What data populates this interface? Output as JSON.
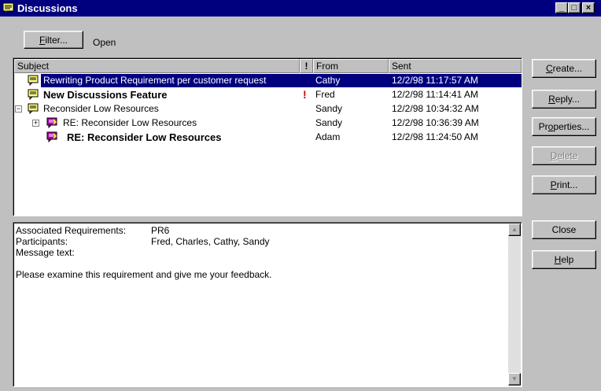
{
  "window": {
    "title": "Discussions",
    "minimize": "_",
    "maximize": "□",
    "close": "×"
  },
  "toolbar": {
    "filter_label": "Filter...",
    "filter_mnemonic": "F",
    "filter_rest": "ilter...",
    "status": "Open"
  },
  "list": {
    "columns": {
      "subject": "Subject",
      "priority": "!",
      "from": "From",
      "sent": "Sent"
    },
    "rows": [
      {
        "subject": "Rewriting Product Requirement per customer request",
        "priority": "",
        "from": "Cathy",
        "sent": "12/2/98 11:17:57 AM"
      },
      {
        "subject": "New Discussions Feature",
        "priority": "!",
        "from": "Fred",
        "sent": "12/2/98 11:14:41 AM"
      },
      {
        "subject": "Reconsider Low Resources",
        "priority": "",
        "from": "Sandy",
        "sent": "12/2/98 10:34:32 AM"
      },
      {
        "subject": "RE: Reconsider Low Resources",
        "priority": "",
        "from": "Sandy",
        "sent": "12/2/98 10:36:39 AM"
      },
      {
        "subject": "RE: Reconsider Low Resources",
        "priority": "",
        "from": "Adam",
        "sent": "12/2/98 11:24:50 AM"
      }
    ]
  },
  "detail": {
    "assoc_label": "Associated Requirements:",
    "assoc_value": "PR6",
    "participants_label": "Participants:",
    "participants_value": "Fred, Charles, Cathy, Sandy",
    "message_label": "Message text:",
    "message": "Please examine this requirement and give me your feedback."
  },
  "buttons": {
    "create": {
      "mn": "C",
      "rest": "reate..."
    },
    "reply": {
      "mn": "R",
      "rest": "eply..."
    },
    "properties": {
      "pre": "Pr",
      "mn": "o",
      "rest": "perties..."
    },
    "delete": {
      "mn": "D",
      "rest": "elete"
    },
    "print": {
      "mn": "P",
      "rest": "rint..."
    },
    "close": "Close",
    "help": {
      "mn": "H",
      "rest": "elp"
    }
  },
  "colors": {
    "titlebar": "#00007f",
    "selection": "#00007f",
    "face": "#c0c0c0",
    "priority": "#d00000"
  }
}
